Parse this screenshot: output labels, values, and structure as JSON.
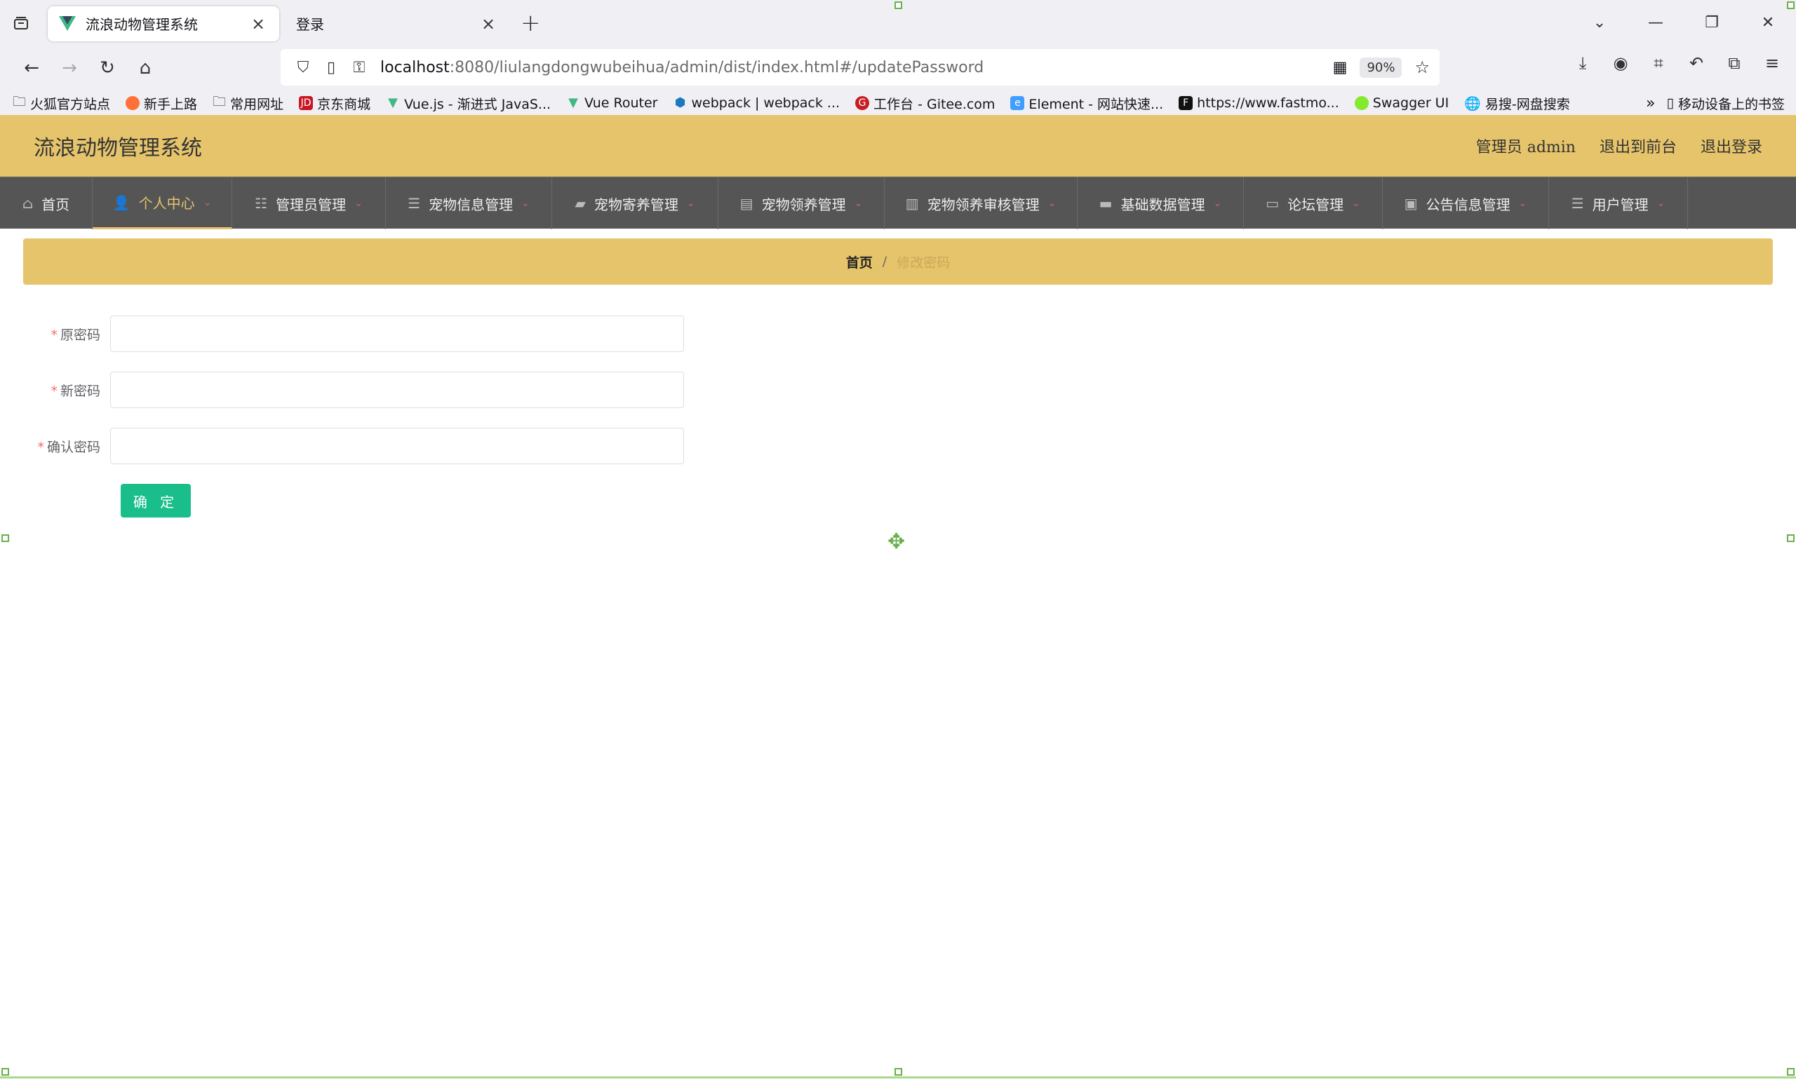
{
  "browser": {
    "tabs": [
      {
        "title": "流浪动物管理系统",
        "active": true
      },
      {
        "title": "登录",
        "active": false
      }
    ],
    "url_host": "localhost",
    "url_rest": ":8080/liulangdongwubeihua/admin/dist/index.html#/updatePassword",
    "zoom": "90%",
    "bookmarks": [
      "火狐官方站点",
      "新手上路",
      "常用网址",
      "京东商城",
      "Vue.js - 渐进式 JavaS...",
      "Vue Router",
      "webpack | webpack ...",
      "工作台 - Gitee.com",
      "Element - 网站快速...",
      "https://www.fastmo...",
      "Swagger UI",
      "易搜-网盘搜索"
    ],
    "mobile_bookmarks": "移动设备上的书签"
  },
  "header": {
    "title": "流浪动物管理系统",
    "user_label": "管理员 admin",
    "to_front": "退出到前台",
    "logout": "退出登录"
  },
  "menu": [
    {
      "label": "首页",
      "icon": "home-icon",
      "active": false,
      "dropdown": false
    },
    {
      "label": "个人中心",
      "icon": "user-icon",
      "active": true,
      "dropdown": true
    },
    {
      "label": "管理员管理",
      "icon": "sliders-icon",
      "active": false,
      "dropdown": true
    },
    {
      "label": "宠物信息管理",
      "icon": "list-icon",
      "active": false,
      "dropdown": true
    },
    {
      "label": "宠物寄养管理",
      "icon": "ticket-icon",
      "active": false,
      "dropdown": true
    },
    {
      "label": "宠物领养管理",
      "icon": "clipboard-icon",
      "active": false,
      "dropdown": true
    },
    {
      "label": "宠物领养审核管理",
      "icon": "book-icon",
      "active": false,
      "dropdown": true
    },
    {
      "label": "基础数据管理",
      "icon": "monitor-icon",
      "active": false,
      "dropdown": true
    },
    {
      "label": "论坛管理",
      "icon": "chat-icon",
      "active": false,
      "dropdown": true
    },
    {
      "label": "公告信息管理",
      "icon": "briefcase-icon",
      "active": false,
      "dropdown": true
    },
    {
      "label": "用户管理",
      "icon": "list-icon",
      "active": false,
      "dropdown": true
    }
  ],
  "breadcrumb": {
    "home": "首页",
    "separator": "/",
    "current": "修改密码"
  },
  "form": {
    "old_password_label": "原密码",
    "new_password_label": "新密码",
    "confirm_password_label": "确认密码",
    "required_mark": "*",
    "submit_label": "确 定"
  }
}
